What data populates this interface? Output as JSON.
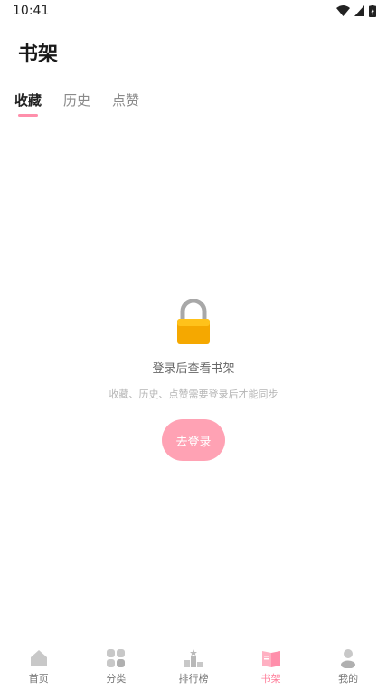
{
  "status": {
    "time": "10:41",
    "icons": [
      "wifi-icon",
      "signal-icon",
      "battery-icon"
    ]
  },
  "header": {
    "title": "书架"
  },
  "tabs": [
    {
      "label": "收藏",
      "active": true
    },
    {
      "label": "历史",
      "active": false
    },
    {
      "label": "点赞",
      "active": false
    }
  ],
  "empty_state": {
    "icon": "lock-icon",
    "title": "登录后查看书架",
    "subtitle": "收藏、历史、点赞需要登录后才能同步",
    "button_label": "去登录"
  },
  "bottom_nav": [
    {
      "label": "首页",
      "icon": "home-icon",
      "active": false
    },
    {
      "label": "分类",
      "icon": "category-icon",
      "active": false
    },
    {
      "label": "排行榜",
      "icon": "ranking-icon",
      "active": false
    },
    {
      "label": "书架",
      "icon": "bookshelf-icon",
      "active": true
    },
    {
      "label": "我的",
      "icon": "profile-icon",
      "active": false
    }
  ],
  "colors": {
    "accent": "#ff8fab",
    "button": "#ffa2b4",
    "lock_body": "#f5a800",
    "lock_shackle": "#a8a8a8"
  }
}
